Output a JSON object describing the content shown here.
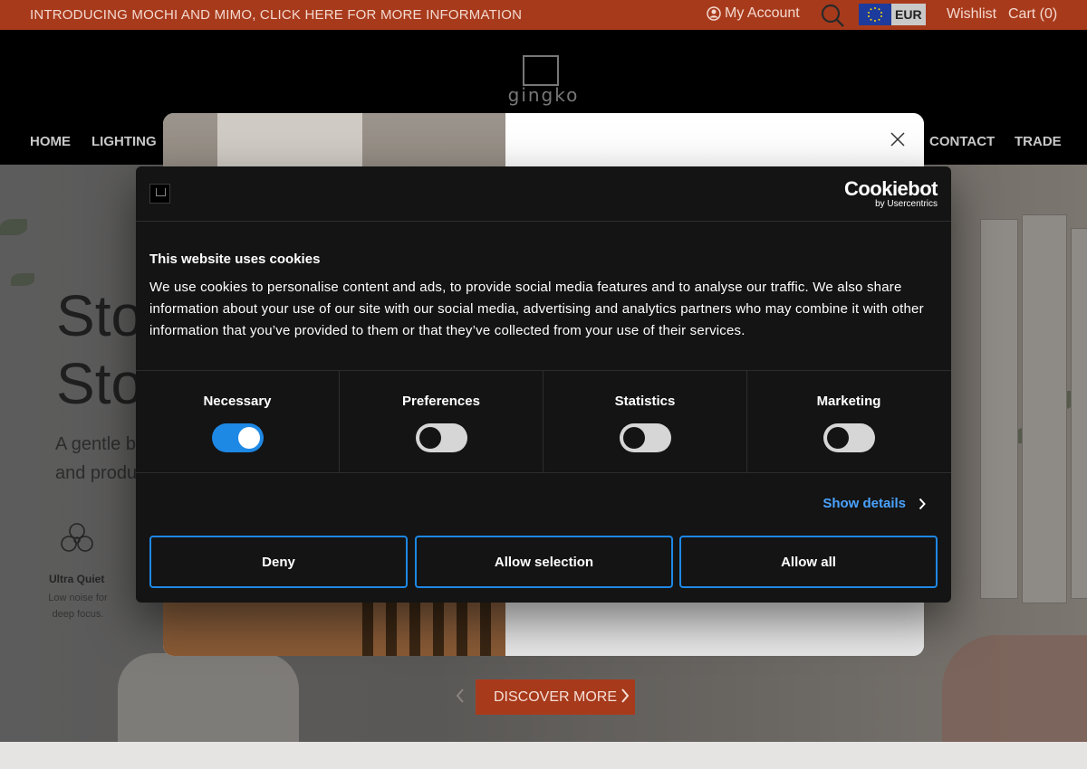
{
  "topbar": {
    "promo": "INTRODUCING MOCHI AND MIMO, CLICK HERE FOR MORE INFORMATION",
    "account": "My Account",
    "currency": "EUR",
    "wishlist": "Wishlist",
    "cart": "Cart (0)",
    "icons": [
      "user-icon",
      "search-icon",
      "eu-flag-icon"
    ]
  },
  "header": {
    "logo_text": "gingko",
    "nav": [
      "HOME",
      "LIGHTING",
      "CONTACT",
      "TRADE"
    ]
  },
  "hero": {
    "headline": [
      "Sto",
      "Sto"
    ],
    "sub": [
      "A gentle b",
      "and produ"
    ],
    "feature": {
      "title": "Ultra Quiet",
      "desc": "Low noise for deep focus."
    },
    "discover": "DISCOVER MORE"
  },
  "cookie": {
    "brand": "Cookiebot",
    "brand_by": "by Usercentrics",
    "title": "This website uses cookies",
    "body": "We use cookies to personalise content and ads, to provide social media features and to analyse our traffic. We also share information about your use of our site with our social media, advertising and analytics partners who may combine it with other information that you’ve provided to them or that they’ve collected from your use of their services.",
    "categories": [
      {
        "label": "Necessary",
        "checked": true
      },
      {
        "label": "Preferences",
        "checked": false
      },
      {
        "label": "Statistics",
        "checked": false
      },
      {
        "label": "Marketing",
        "checked": false
      }
    ],
    "show_details": "Show details",
    "buttons": {
      "deny": "Deny",
      "allow_selection": "Allow selection",
      "allow_all": "Allow all"
    },
    "accent": "#1e88e5"
  },
  "colors": {
    "brand": "#a83a1c",
    "header_bg": "#000000",
    "dialog_bg": "#141414"
  }
}
